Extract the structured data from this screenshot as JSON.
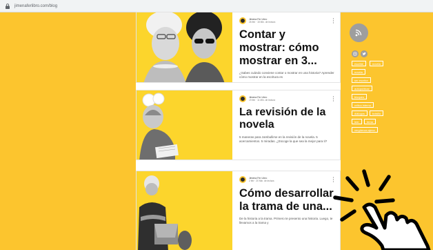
{
  "browser": {
    "url": "jimenaferlibro.com/blog"
  },
  "posts": [
    {
      "author": "Jimena Fer Libro",
      "date": "26 feb · 15 Min. de lectura",
      "title": "Contar y mostrar: cómo mostrar en 3...",
      "excerpt": "¿Sabes cuándo conviene contar o mostrar en una historia? Aprender cómo mostrar en la escritura es"
    },
    {
      "author": "Jimena Fer Libro",
      "date": "19 feb · 11 Min. de lectura",
      "title": "La revisión de la novela",
      "excerpt": "5 maneras para zambullirse en la revisión de la novela. 5 acercamientos. 5 miradas. ¿Escoge la que sea la mejor para ti?"
    },
    {
      "author": "Jimena Fer Libro",
      "date": "2 feb · 20 Min. de lectura",
      "title": "Cómo desarrollar la trama de una...",
      "excerpt": "De la historia a la trama. Primero te presento una historia. Luego, te llevamos a la trama y"
    }
  ],
  "sidebar": {
    "tags": [
      "escribir",
      "novela",
      "novela",
      "ser escritor",
      "autopublicar",
      "bloqueo",
      "crítico interno",
      "diálogos",
      "bolsillo",
      "leer",
      "tema",
      "vergüenza ajena"
    ]
  },
  "colors": {
    "background": "#fcc52e",
    "post_image_bg": "#fcd52c",
    "icon_gray": "#9e9e9e"
  },
  "icons": [
    "lock-icon",
    "rss-icon",
    "instagram-icon",
    "twitter-icon",
    "kebab-menu-icon",
    "hand-pointer-icon"
  ]
}
